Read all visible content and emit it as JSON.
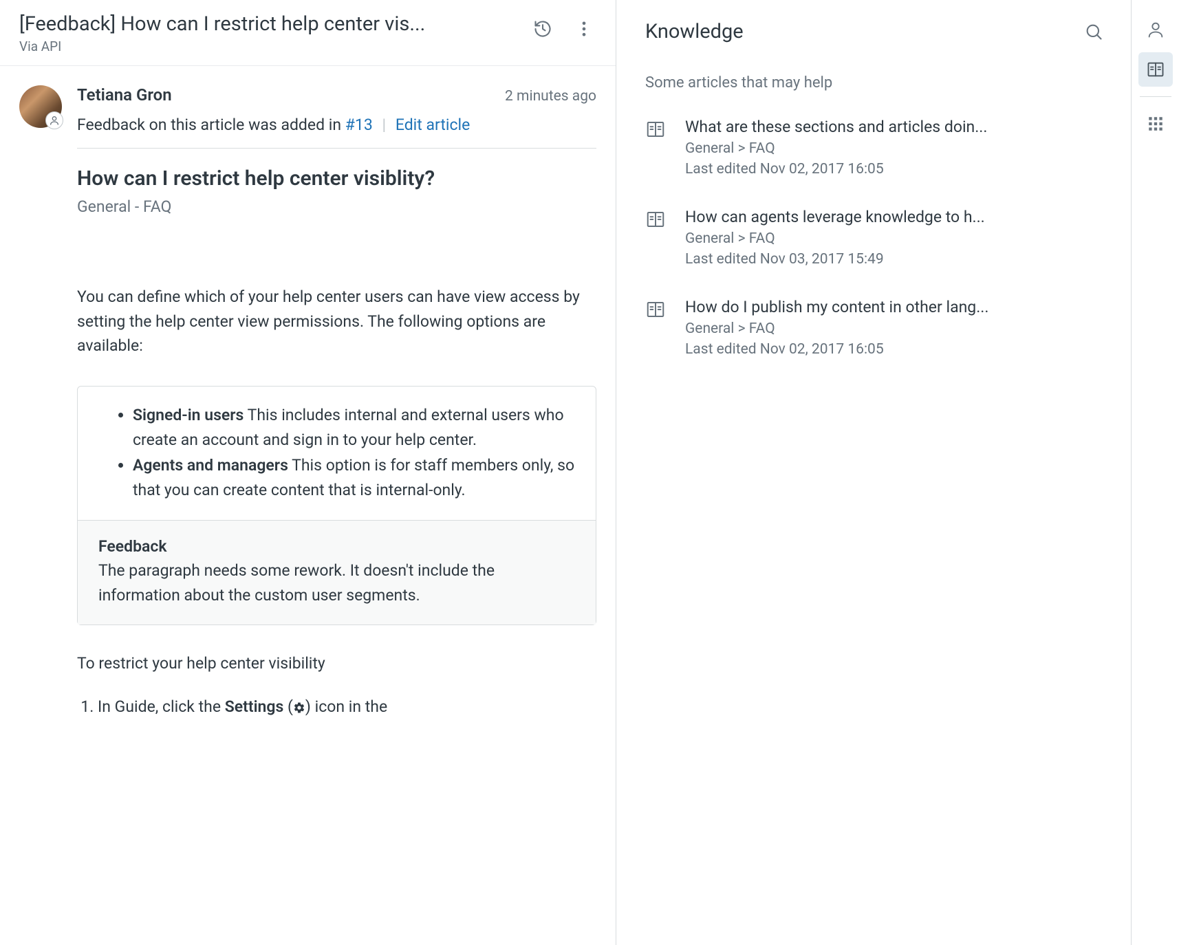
{
  "header": {
    "title": "[Feedback] How can I restrict help center vis...",
    "subtitle": "Via API"
  },
  "comment": {
    "author": "Tetiana Gron",
    "timestamp": "2 minutes ago",
    "feedback_prefix": "Feedback on this article was added in ",
    "feedback_link": "#13",
    "edit_article_label": "Edit article"
  },
  "article": {
    "title": "How can I restrict help center visiblity?",
    "breadcrumb": "General - FAQ",
    "intro": "You can define which of your help center users can have view access by setting the help center view permissions. The following options are available:",
    "option1_label": "Signed-in users",
    "option1_text": " This includes internal and external users who create an account and sign in to your help center.",
    "option2_label": "Agents and managers",
    "option2_text": " This option is for staff members only, so that you can create content that is internal-only.",
    "feedback_box_title": "Feedback",
    "feedback_box_text": "The paragraph needs some rework. It doesn't include the information about the custom user segments.",
    "instructions_intro": "To restrict your help center visibility",
    "step1_prefix": "In Guide, click the ",
    "step1_bold": "Settings",
    "step1_open_paren": " (",
    "step1_close": ") icon in the"
  },
  "knowledge": {
    "title": "Knowledge",
    "subtitle": "Some articles that may help",
    "items": [
      {
        "title": "What are these sections and articles doin...",
        "category": "General > FAQ",
        "edited": "Last edited Nov 02, 2017 16:05"
      },
      {
        "title": "How can agents leverage knowledge to h...",
        "category": "General > FAQ",
        "edited": "Last edited Nov 03, 2017 15:49"
      },
      {
        "title": "How do I publish my content in other lang...",
        "category": "General > FAQ",
        "edited": "Last edited Nov 02, 2017 16:05"
      }
    ]
  }
}
